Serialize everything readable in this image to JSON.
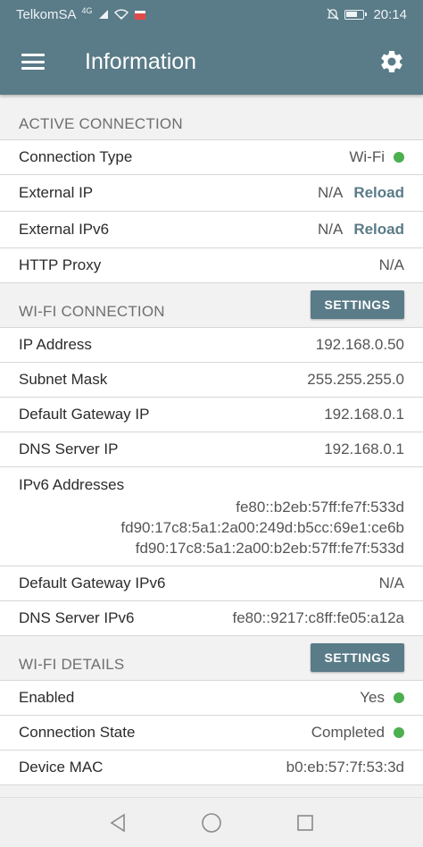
{
  "status_bar": {
    "carrier": "TelkomSA",
    "network": "4G",
    "time": "20:14"
  },
  "app_bar": {
    "title": "Information"
  },
  "active_connection": {
    "title": "ACTIVE CONNECTION",
    "rows": [
      {
        "label": "Connection Type",
        "value": "Wi-Fi"
      },
      {
        "label": "External IP",
        "value": "N/A",
        "action": "Reload"
      },
      {
        "label": "External IPv6",
        "value": "N/A",
        "action": "Reload"
      },
      {
        "label": "HTTP Proxy",
        "value": "N/A"
      }
    ]
  },
  "wifi_connection": {
    "title": "WI-FI CONNECTION",
    "button": "SETTINGS",
    "rows": [
      {
        "label": "IP Address",
        "value": "192.168.0.50"
      },
      {
        "label": "Subnet Mask",
        "value": "255.255.255.0"
      },
      {
        "label": "Default Gateway IP",
        "value": "192.168.0.1"
      },
      {
        "label": "DNS Server IP",
        "value": "192.168.0.1"
      }
    ],
    "ipv6": {
      "label": "IPv6 Addresses",
      "values": [
        "fe80::b2eb:57ff:fe7f:533d",
        "fd90:17c8:5a1:2a00:249d:b5cc:69e1:ce6b",
        "fd90:17c8:5a1:2a00:b2eb:57ff:fe7f:533d"
      ]
    },
    "rows2": [
      {
        "label": "Default Gateway IPv6",
        "value": "N/A"
      },
      {
        "label": "DNS Server IPv6",
        "value": "fe80::9217:c8ff:fe05:a12a"
      }
    ]
  },
  "wifi_details": {
    "title": "WI-FI DETAILS",
    "button": "SETTINGS",
    "rows": [
      {
        "label": "Enabled",
        "value": "Yes"
      },
      {
        "label": "Connection State",
        "value": "Completed"
      },
      {
        "label": "Device MAC",
        "value": "b0:eb:57:7f:53:3d"
      }
    ]
  },
  "colors": {
    "primary": "#5a7b88",
    "status_ok": "#4caf50"
  }
}
